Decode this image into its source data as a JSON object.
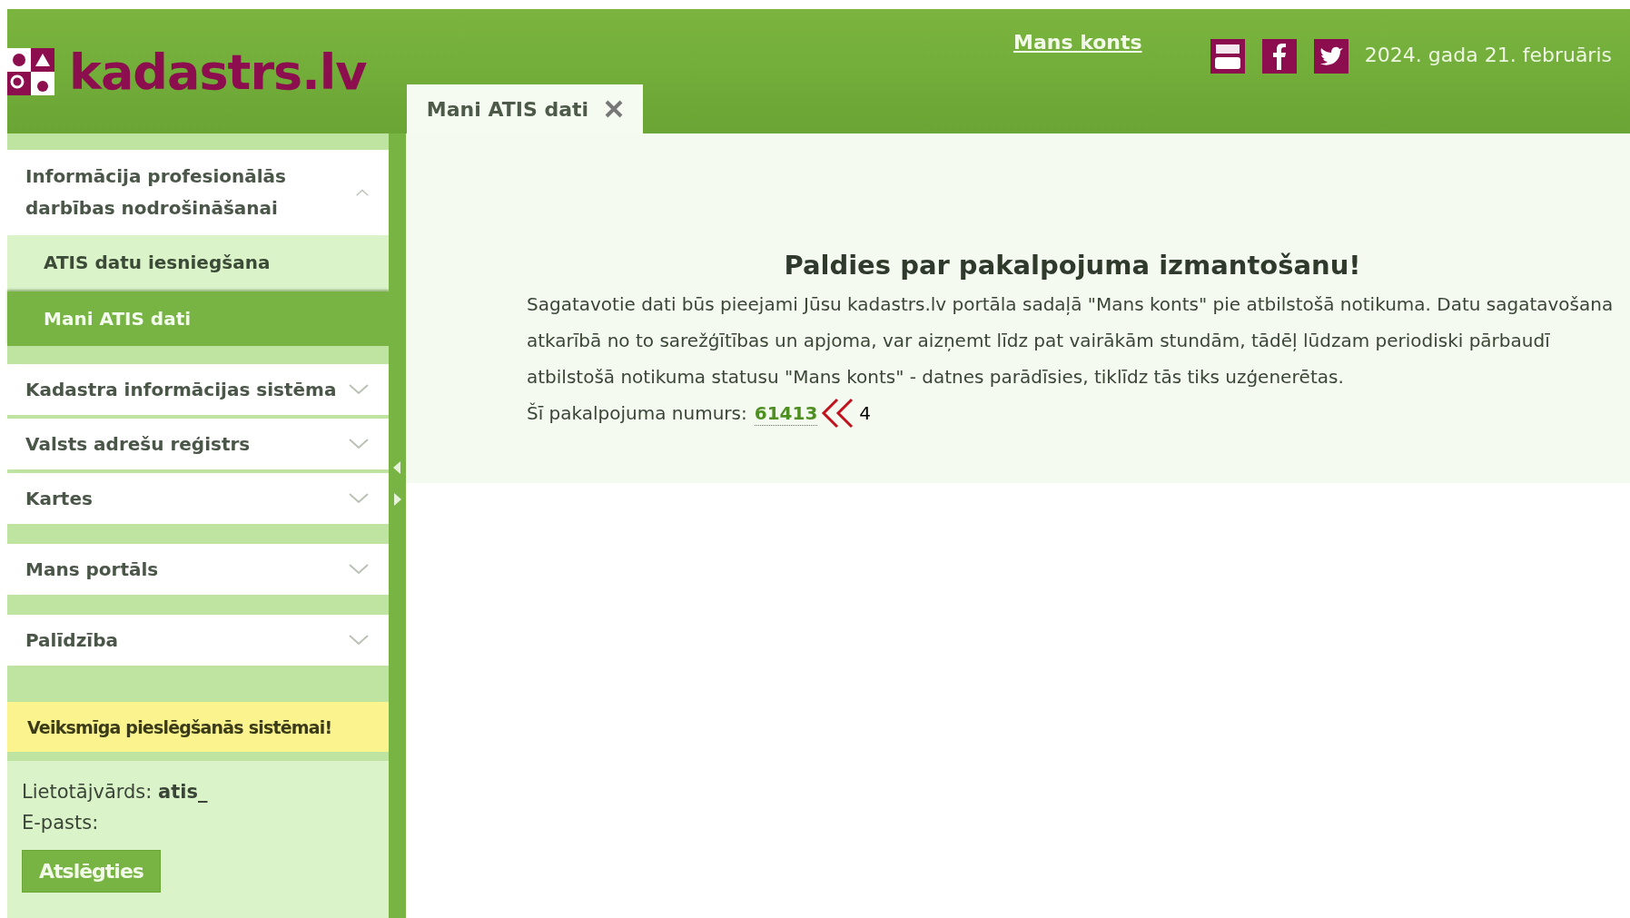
{
  "header": {
    "logo_text": "kadastrs.lv",
    "account_link": "Mans konts",
    "date": "2024. gada 21. februāris"
  },
  "tabs": [
    {
      "label": "Mani ATIS dati",
      "selected": true
    }
  ],
  "sidebar": {
    "items": [
      {
        "label": "Informācija profesionālās darbības nodrošināšanai",
        "expanded": true,
        "children": [
          {
            "label": "ATIS datu iesniegšana",
            "selected": false
          },
          {
            "label": "Mani ATIS dati",
            "selected": true
          }
        ]
      },
      {
        "label": "Kadastra informācijas sistēma",
        "expanded": false
      },
      {
        "label": "Valsts adrešu reģistrs",
        "expanded": false
      },
      {
        "label": "Kartes",
        "expanded": false
      },
      {
        "label": "Mans portāls",
        "expanded": false
      },
      {
        "label": "Palīdzība",
        "expanded": false
      }
    ],
    "notice": "Veiksmīga pieslēgšanās sistēmai!",
    "user_label": "Lietotājvārds:",
    "user_value": "atis_",
    "email_label": "E-pasts:",
    "logout_button": "Atslēgties"
  },
  "content": {
    "title": "Paldies par pakalpojuma izmantošanu!",
    "lines": [
      "Sagatavotie dati būs pieejami Jūsu kadastrs.lv portāla sadaļā \"Mans konts\" pie atbilstošā notikuma. Datu sagatavošana",
      "atkarībā no to sarežģītības un apjoma, var aizņemt līdz pat vairākām stundām, tādēļ lūdzam periodiski pārbaudī",
      "atbilstošā notikuma statusu \"Mans konts\" - datnes parādīsies, tiklīdz tās tiks uzģenerētas."
    ],
    "number_label": "Šī pakalpojuma numurs:",
    "number": "61413",
    "number_tail": "4"
  }
}
